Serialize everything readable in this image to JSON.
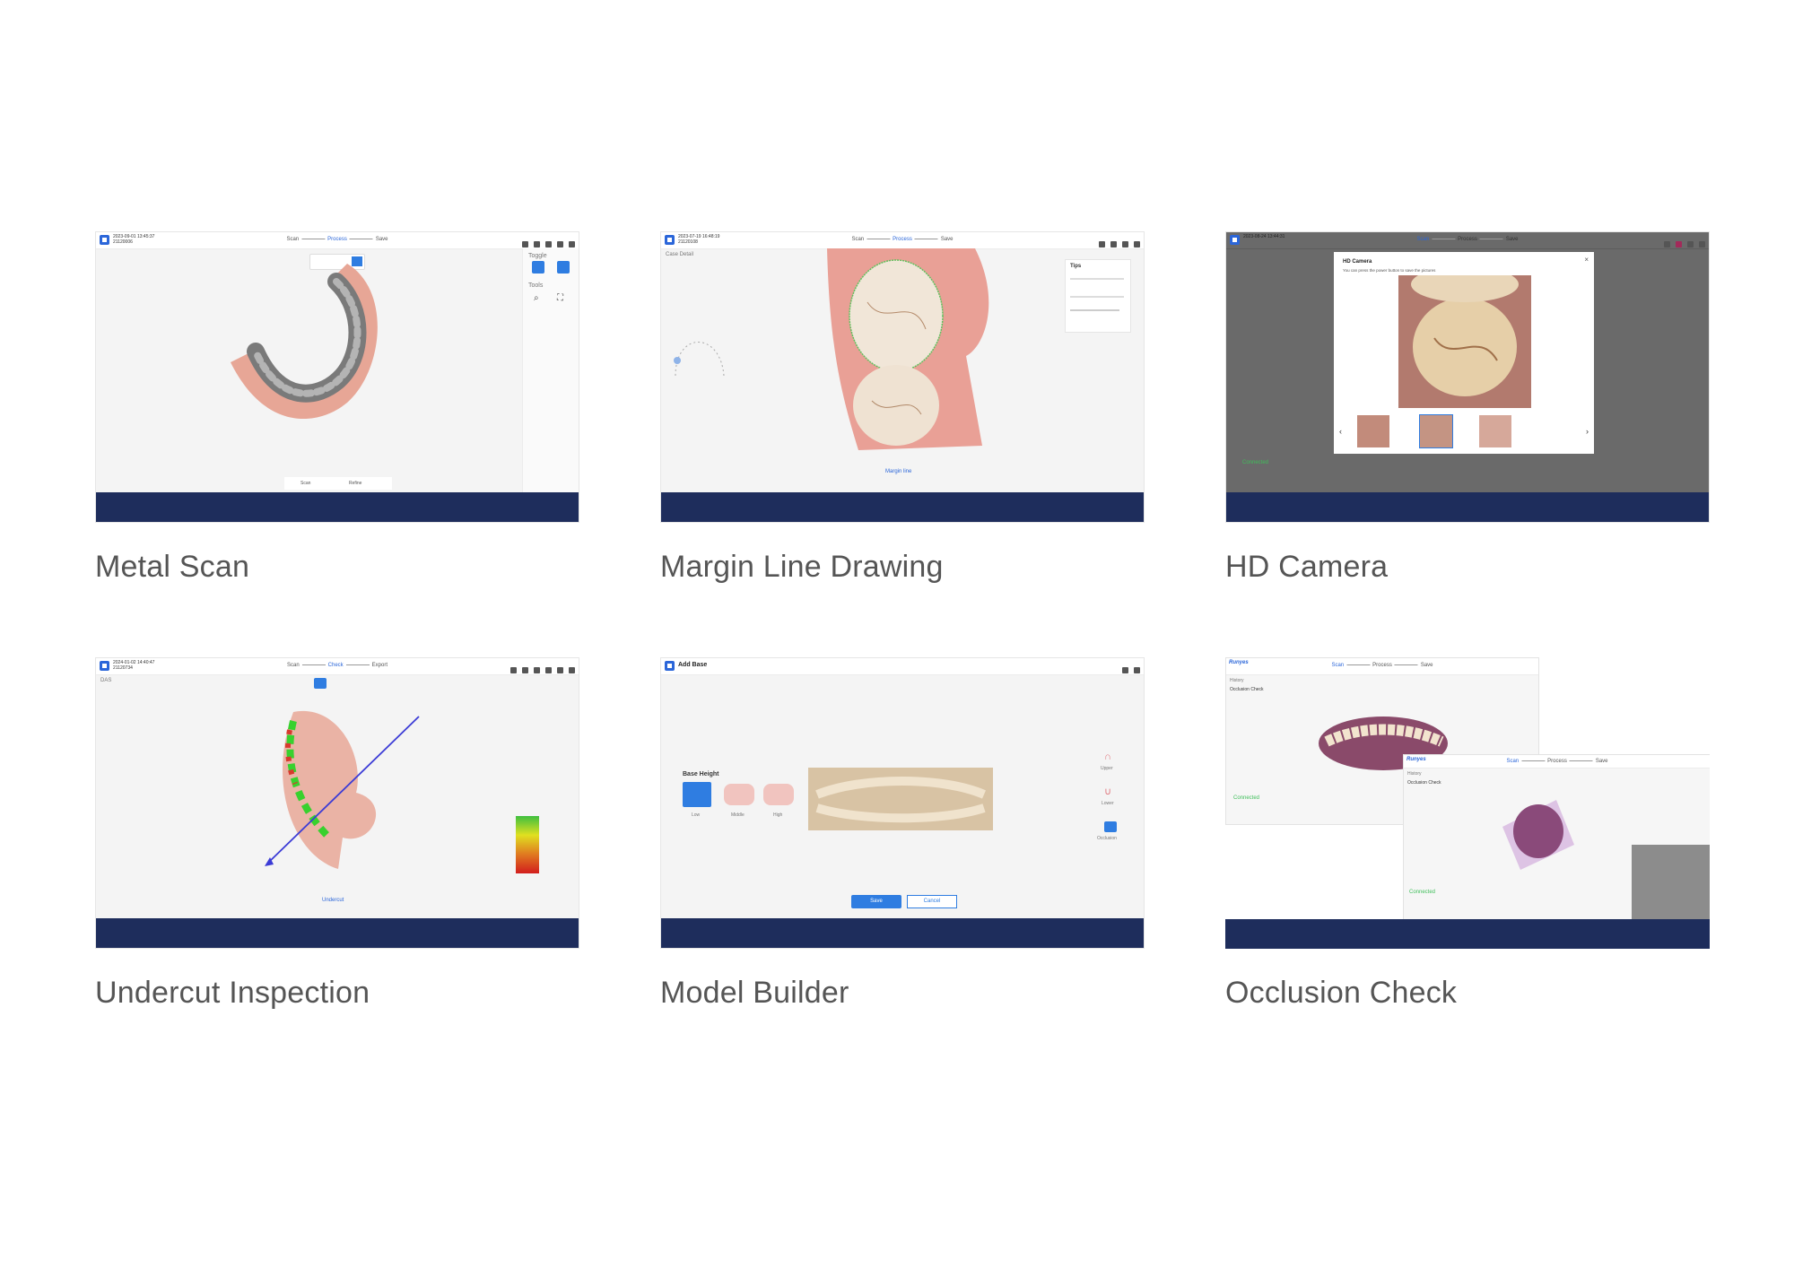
{
  "cards": [
    {
      "caption": "Metal Scan",
      "toolbar": {
        "title": "2023-09-01 13:45:37",
        "sub": "21120006",
        "steps": [
          "Scan",
          "Process",
          "Save"
        ],
        "active": 1
      },
      "panel": {
        "toggle": "Toggle",
        "tools": "Tools"
      },
      "bottom": {
        "scan": "Scan",
        "refine": "Refine"
      }
    },
    {
      "caption": "Margin Line Drawing",
      "toolbar": {
        "title": "2023-07-19 16:48:19",
        "sub": "21120108",
        "steps": [
          "Scan",
          "Process",
          "Save"
        ],
        "active": 1
      },
      "side_label": "Case Detail",
      "tips": {
        "title": "Tips"
      },
      "bottom": {
        "label": "Margin line"
      }
    },
    {
      "caption": "HD Camera",
      "toolbar": {
        "title": "2023-08-24 13:44:31",
        "sub": "",
        "steps": [
          "Scan",
          "Process",
          "Save"
        ],
        "active": 0
      },
      "modal": {
        "title": "HD Camera",
        "desc": "You can press the power button to save the pictures"
      },
      "status": "Connected"
    },
    {
      "caption": "Undercut Inspection",
      "toolbar": {
        "title": "2024-01-02 14:40:47",
        "sub": "21120734",
        "steps": [
          "Scan",
          "Check",
          "Export"
        ],
        "active": 1
      },
      "corner_label": "DAS",
      "bottom": {
        "label": "Undercut"
      }
    },
    {
      "caption": "Model Builder",
      "toolbar": {
        "title": "Add Base"
      },
      "base": {
        "heading": "Base Height",
        "options": [
          "Low",
          "Middle",
          "High"
        ]
      },
      "views": [
        "Upper",
        "Lower",
        "Occlusion"
      ],
      "buttons": {
        "save": "Save",
        "cancel": "Cancel"
      }
    },
    {
      "caption": "Occlusion Check",
      "toolbar": {
        "title": "Runyes",
        "steps": [
          "Scan",
          "Process",
          "Save"
        ]
      },
      "left": {
        "history": "History",
        "check": "Occlusion Check"
      },
      "status": "Connected"
    }
  ],
  "colors": {
    "accent": "#2b66d9",
    "band": "#1e2d5c",
    "caption": "#555555"
  }
}
